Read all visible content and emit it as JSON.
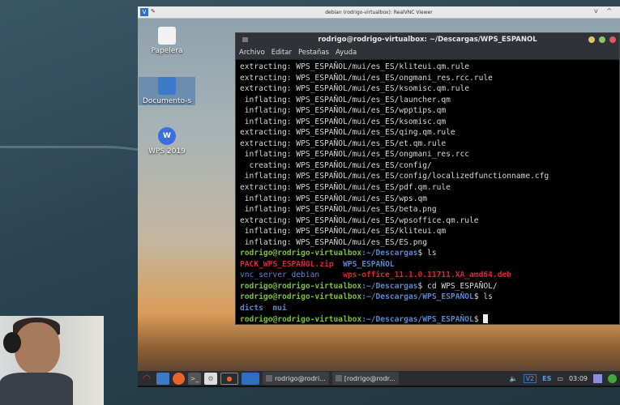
{
  "vnc": {
    "title": "debian (rodrigo-virtualbox): RealVNC Viewer",
    "controls": "v ^"
  },
  "desktop_icons": [
    {
      "label": "Papelera"
    },
    {
      "label": "Documento-s"
    },
    {
      "label": "WPS 2019"
    }
  ],
  "terminal": {
    "title": "rodrigo@rodrigo-virtualbox: ~/Descargas/WPS_ESPANOL",
    "menu": [
      "Archivo",
      "Editar",
      "Pestañas",
      "Ayuda"
    ],
    "output_lines": [
      "extracting: WPS_ESPAÑOL/mui/es_ES/kliteui.qm.rule",
      "extracting: WPS_ESPAÑOL/mui/es_ES/ongmani_res.rcc.rule",
      "extracting: WPS_ESPAÑOL/mui/es_ES/ksomisc.qm.rule",
      " inflating: WPS_ESPAÑOL/mui/es_ES/launcher.qm",
      " inflating: WPS_ESPAÑOL/mui/es_ES/wpptips.qm",
      " inflating: WPS_ESPAÑOL/mui/es_ES/ksomisc.qm",
      "extracting: WPS_ESPAÑOL/mui/es_ES/qing.qm.rule",
      "extracting: WPS_ESPAÑOL/mui/es_ES/et.qm.rule",
      " inflating: WPS_ESPAÑOL/mui/es_ES/ongmani_res.rcc",
      "  creating: WPS_ESPAÑOL/mui/es_ES/config/",
      " inflating: WPS_ESPAÑOL/mui/es_ES/config/localizedfunctionname.cfg",
      "extracting: WPS_ESPAÑOL/mui/es_ES/pdf.qm.rule",
      " inflating: WPS_ESPAÑOL/mui/es_ES/wps.qm",
      " inflating: WPS_ESPAÑOL/mui/es_ES/beta.png",
      "extracting: WPS_ESPAÑOL/mui/es_ES/wpsoffice.qm.rule",
      " inflating: WPS_ESPAÑOL/mui/es_ES/kliteui.qm",
      " inflating: WPS_ESPAÑOL/mui/es_ES/ES.png"
    ],
    "prompt_user": "rodrigo@rodrigo-virtualbox",
    "path1": ":~/Descargas",
    "path2": ":~/Descargas/WPS_ESPAÑOL",
    "cmd_ls": "$ ls",
    "cmd_cd": "$ cd WPS_ESPAÑOL/",
    "dollar": "$ ",
    "ls1": {
      "a": "PACK_WPS_ESPAÑOL.zip",
      "b": "WPS_ESPAÑOL",
      "c": "vnc_server_debian",
      "d": "wps-office_11.1.0.11711.XA_amd64.deb"
    },
    "ls2": {
      "a": "dicts",
      "b": "mui"
    }
  },
  "taskbar": {
    "tasks": [
      "rodrigo@rodri...",
      "[rodrigo@rodr..."
    ],
    "lang": "ES",
    "clock": "03:09"
  },
  "colors": {
    "prompt": "#7ec13a",
    "dir": "#5f86c9",
    "archive": "#e0263a"
  }
}
